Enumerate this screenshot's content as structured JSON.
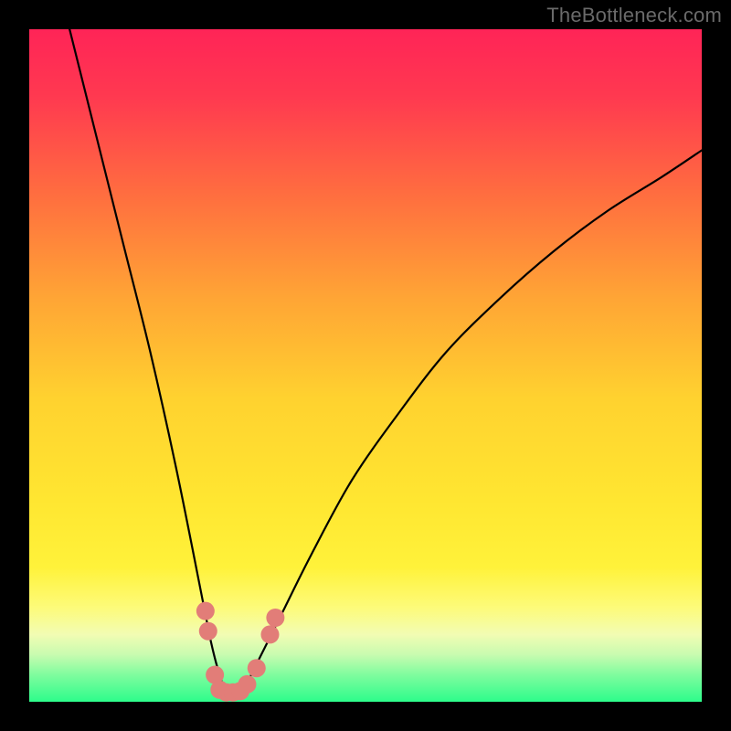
{
  "watermark": "TheBottleneck.com",
  "chart_data": {
    "type": "line",
    "title": "",
    "xlabel": "",
    "ylabel": "",
    "xlim": [
      0,
      100
    ],
    "ylim": [
      0,
      100
    ],
    "grid": false,
    "legend": false,
    "gradient_background": {
      "top_color": "#ff2457",
      "mid_color": "#ffe631",
      "bottom_color": "#2dfc8b"
    },
    "series": [
      {
        "name": "bottleneck-curve",
        "color": "#000000",
        "x": [
          6,
          10,
          14,
          18,
          22,
          26,
          27,
          28,
          29,
          30,
          31,
          32,
          33,
          35,
          38,
          42,
          48,
          55,
          62,
          70,
          78,
          86,
          94,
          100
        ],
        "y": [
          100,
          84,
          68,
          52,
          34,
          14,
          9,
          5,
          2,
          1,
          1,
          2,
          4,
          8,
          14,
          22,
          33,
          43,
          52,
          60,
          67,
          73,
          78,
          82
        ]
      }
    ],
    "markers": [
      {
        "name": "highlight-dots",
        "color": "#e27d78",
        "radius": 10,
        "points": [
          {
            "x": 26.2,
            "y": 13.5
          },
          {
            "x": 26.6,
            "y": 10.5
          },
          {
            "x": 27.6,
            "y": 4.0
          },
          {
            "x": 28.3,
            "y": 1.8
          },
          {
            "x": 29.3,
            "y": 1.4
          },
          {
            "x": 30.3,
            "y": 1.4
          },
          {
            "x": 31.4,
            "y": 1.6
          },
          {
            "x": 32.4,
            "y": 2.6
          },
          {
            "x": 33.8,
            "y": 5.0
          },
          {
            "x": 35.8,
            "y": 10.0
          },
          {
            "x": 36.6,
            "y": 12.5
          }
        ]
      }
    ]
  }
}
